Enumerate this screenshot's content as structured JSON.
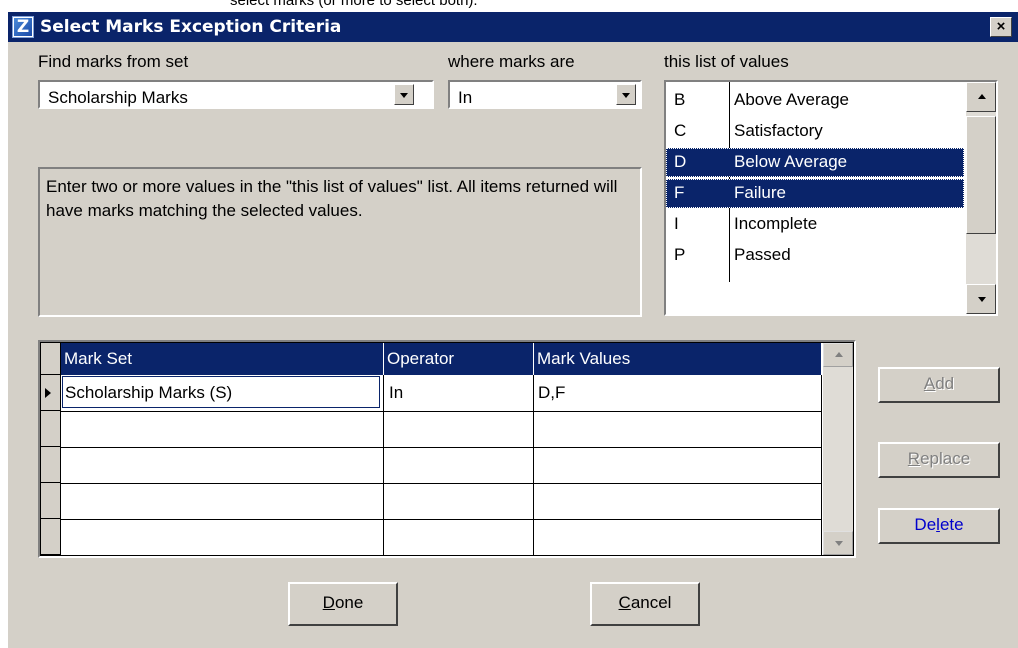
{
  "caption": "select marks (or more to select both).",
  "window": {
    "title": "Select Marks Exception Criteria",
    "close_glyph": "×",
    "icon_letter": "Z"
  },
  "filters": {
    "find_label": "Find marks from set",
    "mark_set_value": "Scholarship Marks",
    "where_label": "where marks are",
    "operator_value": "In",
    "list_label": "this list of values"
  },
  "info_text": "Enter two or more values in the \"this list of values\" list.  All items returned will have marks matching the selected values.",
  "values_list": [
    {
      "code": "B",
      "desc": "Above Average",
      "selected": false
    },
    {
      "code": "C",
      "desc": "Satisfactory",
      "selected": false
    },
    {
      "code": "D",
      "desc": "Below Average",
      "selected": true
    },
    {
      "code": "F",
      "desc": "Failure",
      "selected": true
    },
    {
      "code": "I",
      "desc": "Incomplete",
      "selected": false
    },
    {
      "code": "P",
      "desc": "Passed",
      "selected": false
    }
  ],
  "grid": {
    "columns": [
      "Mark Set",
      "Operator",
      "Mark Values"
    ],
    "rows": [
      {
        "mark_set": "Scholarship Marks (S)",
        "operator": "In",
        "values": "D,F"
      }
    ]
  },
  "buttons": {
    "add": {
      "label": "Add",
      "mnemonic": "A",
      "rest": "dd"
    },
    "replace": {
      "label": "Replace",
      "mnemonic": "R",
      "rest": "eplace"
    },
    "delete": {
      "label": "Delete",
      "pre": "De",
      "mnemonic": "l",
      "rest": "ete"
    },
    "done": {
      "label": "Done",
      "mnemonic": "D",
      "rest": "one"
    },
    "cancel": {
      "label": "Cancel",
      "mnemonic": "C",
      "rest": "ancel"
    }
  }
}
